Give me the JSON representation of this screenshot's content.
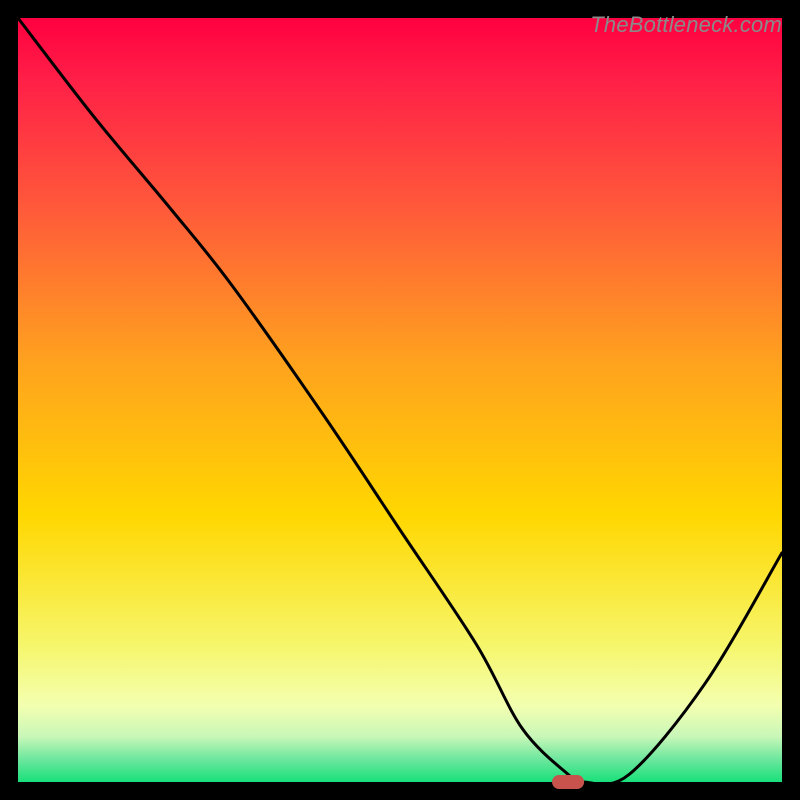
{
  "watermark": "TheBottleneck.com",
  "chart_data": {
    "type": "line",
    "title": "",
    "xlabel": "",
    "ylabel": "",
    "xlim": [
      0,
      100
    ],
    "ylim": [
      0,
      100
    ],
    "x": [
      0,
      10,
      20,
      28,
      40,
      50,
      60,
      66,
      72,
      74,
      80,
      90,
      100
    ],
    "values": [
      100,
      87,
      75,
      65,
      48,
      33,
      18,
      7,
      1,
      0,
      1,
      13,
      30
    ],
    "marker": {
      "x": 72,
      "y": 0,
      "shape": "pill",
      "color": "#c8534d"
    },
    "background": {
      "type": "vertical-gradient",
      "stops": [
        {
          "offset": 0.0,
          "color": "#ff0040"
        },
        {
          "offset": 0.08,
          "color": "#ff1f47"
        },
        {
          "offset": 0.25,
          "color": "#ff5a3a"
        },
        {
          "offset": 0.45,
          "color": "#ffa21e"
        },
        {
          "offset": 0.65,
          "color": "#ffd700"
        },
        {
          "offset": 0.82,
          "color": "#f6f66a"
        },
        {
          "offset": 0.9,
          "color": "#f3ffb0"
        },
        {
          "offset": 0.94,
          "color": "#c9f7b8"
        },
        {
          "offset": 0.97,
          "color": "#6ee79e"
        },
        {
          "offset": 1.0,
          "color": "#18e07a"
        }
      ]
    },
    "border_color": "#000000",
    "line_color": "#000000"
  }
}
